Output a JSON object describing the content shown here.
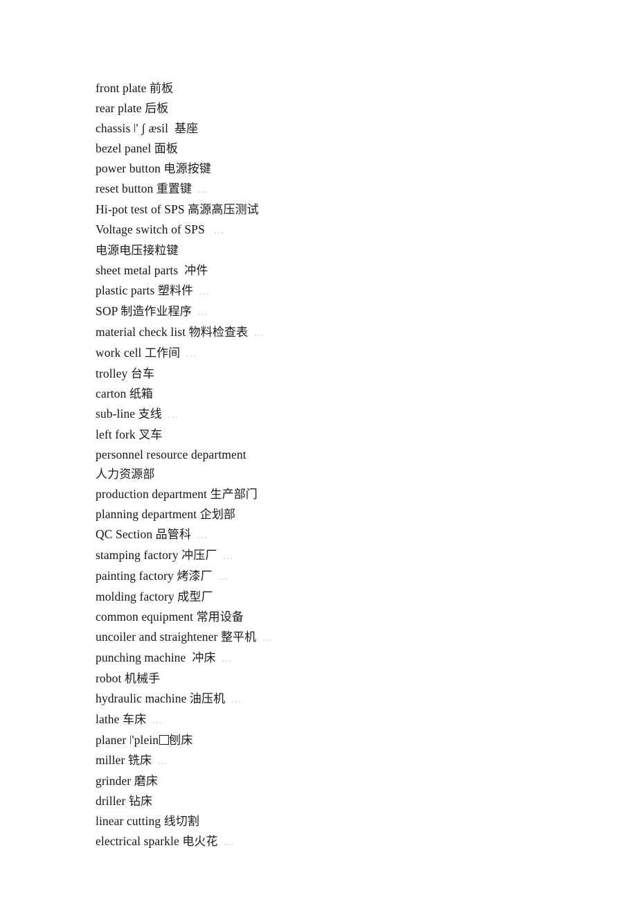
{
  "document": {
    "kind": "scanned-glossary-page",
    "page_background": "#ffffff",
    "text_color": "#151515",
    "artifact_color": "#c8c8c8",
    "entries": [
      {
        "english": "front plate ",
        "chinese": "前板",
        "speckle": false
      },
      {
        "english": "rear plate ",
        "chinese": "后板",
        "speckle": false
      },
      {
        "english": "chassis ǀ' ʃ æsil  ",
        "chinese": "基座",
        "speckle": false
      },
      {
        "english": "bezel panel ",
        "chinese": "面板",
        "speckle": false
      },
      {
        "english": "power button ",
        "chinese": "电源按键",
        "speckle": false
      },
      {
        "english": "reset button ",
        "chinese": "重置键",
        "speckle": true
      },
      {
        "english": "Hi-pot test of SPS ",
        "chinese": "高源高压测试",
        "speckle": false
      },
      {
        "english": "Voltage switch of SPS ",
        "chinese": "",
        "speckle": true
      },
      {
        "english": "",
        "chinese": "电源电压接粒键",
        "speckle": false
      },
      {
        "english": "sheet metal parts  ",
        "chinese": "冲件",
        "speckle": false
      },
      {
        "english": "plastic parts ",
        "chinese": "塑料件",
        "speckle": true
      },
      {
        "english": "SOP ",
        "chinese": "制造作业程序",
        "speckle": true
      },
      {
        "english": "material check list ",
        "chinese": "物料检查表",
        "speckle": true
      },
      {
        "english": "work cell ",
        "chinese": "工作间",
        "speckle": true
      },
      {
        "english": "trolley ",
        "chinese": "台车",
        "speckle": false
      },
      {
        "english": "carton ",
        "chinese": "纸箱",
        "speckle": false
      },
      {
        "english": "sub-line ",
        "chinese": "支线",
        "speckle": true
      },
      {
        "english": "left fork ",
        "chinese": "叉车",
        "speckle": false
      },
      {
        "english": "personnel resource department",
        "chinese": "",
        "speckle": false
      },
      {
        "english": "",
        "chinese": "人力资源部",
        "speckle": false
      },
      {
        "english": "production department ",
        "chinese": "生产部门",
        "speckle": false
      },
      {
        "english": "planning department ",
        "chinese": "企划部",
        "speckle": false
      },
      {
        "english": "QC Section ",
        "chinese": "品管科",
        "speckle": true
      },
      {
        "english": "stamping factory ",
        "chinese": "冲压厂",
        "speckle": true
      },
      {
        "english": "painting factory ",
        "chinese": "烤漆厂",
        "speckle": true
      },
      {
        "english": "molding factory ",
        "chinese": "成型厂",
        "speckle": false
      },
      {
        "english": "common equipment ",
        "chinese": "常用设备",
        "speckle": false
      },
      {
        "english": "uncoiler and straightener ",
        "chinese": "整平机",
        "speckle": true
      },
      {
        "english": "punching machine  ",
        "chinese": "冲床",
        "speckle": true
      },
      {
        "english": "robot ",
        "chinese": "机械手",
        "speckle": false
      },
      {
        "english": "hydraulic machine ",
        "chinese": "油压机",
        "speckle": true
      },
      {
        "english": "lathe ",
        "chinese": "车床",
        "speckle": true
      },
      {
        "english": "planer ǀ'plein",
        "tofu": true,
        "chinese": "刨床",
        "speckle": false
      },
      {
        "english": "miller ",
        "chinese": "铣床",
        "speckle": true
      },
      {
        "english": "grinder ",
        "chinese": "磨床",
        "speckle": false
      },
      {
        "english": "driller ",
        "chinese": "钻床",
        "speckle": false
      },
      {
        "english": "linear cutting ",
        "chinese": "线切割",
        "speckle": false
      },
      {
        "english": "electrical sparkle ",
        "chinese": "电火花",
        "speckle": true
      }
    ],
    "speckle_glyph": "…"
  }
}
